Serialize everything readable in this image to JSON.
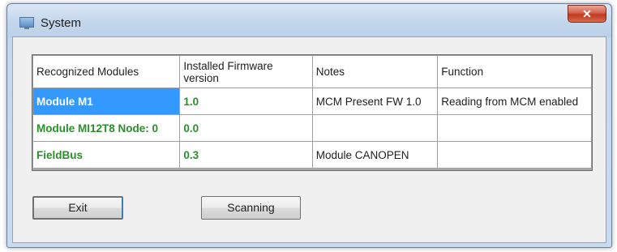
{
  "window": {
    "title": "System",
    "close_glyph": "✕"
  },
  "table": {
    "headers": [
      "Recognized Modules",
      "Installed Firmware version",
      "Notes",
      "Function"
    ],
    "rows": [
      [
        "Module M1",
        "1.0",
        "MCM Present FW 1.0",
        "Reading from MCM enabled"
      ],
      [
        "Module MI12T8 Node: 0",
        "0.0",
        "",
        ""
      ],
      [
        "FieldBus",
        "0.3",
        "Module CANOPEN",
        ""
      ]
    ]
  },
  "buttons": {
    "exit": "Exit",
    "scanning": "Scanning"
  },
  "colors": {
    "selection": "#3399ff",
    "module_text": "#2a8f2a",
    "close_button": "#c0391f"
  },
  "icons": {
    "title": "system-window-icon",
    "close": "close-icon"
  }
}
